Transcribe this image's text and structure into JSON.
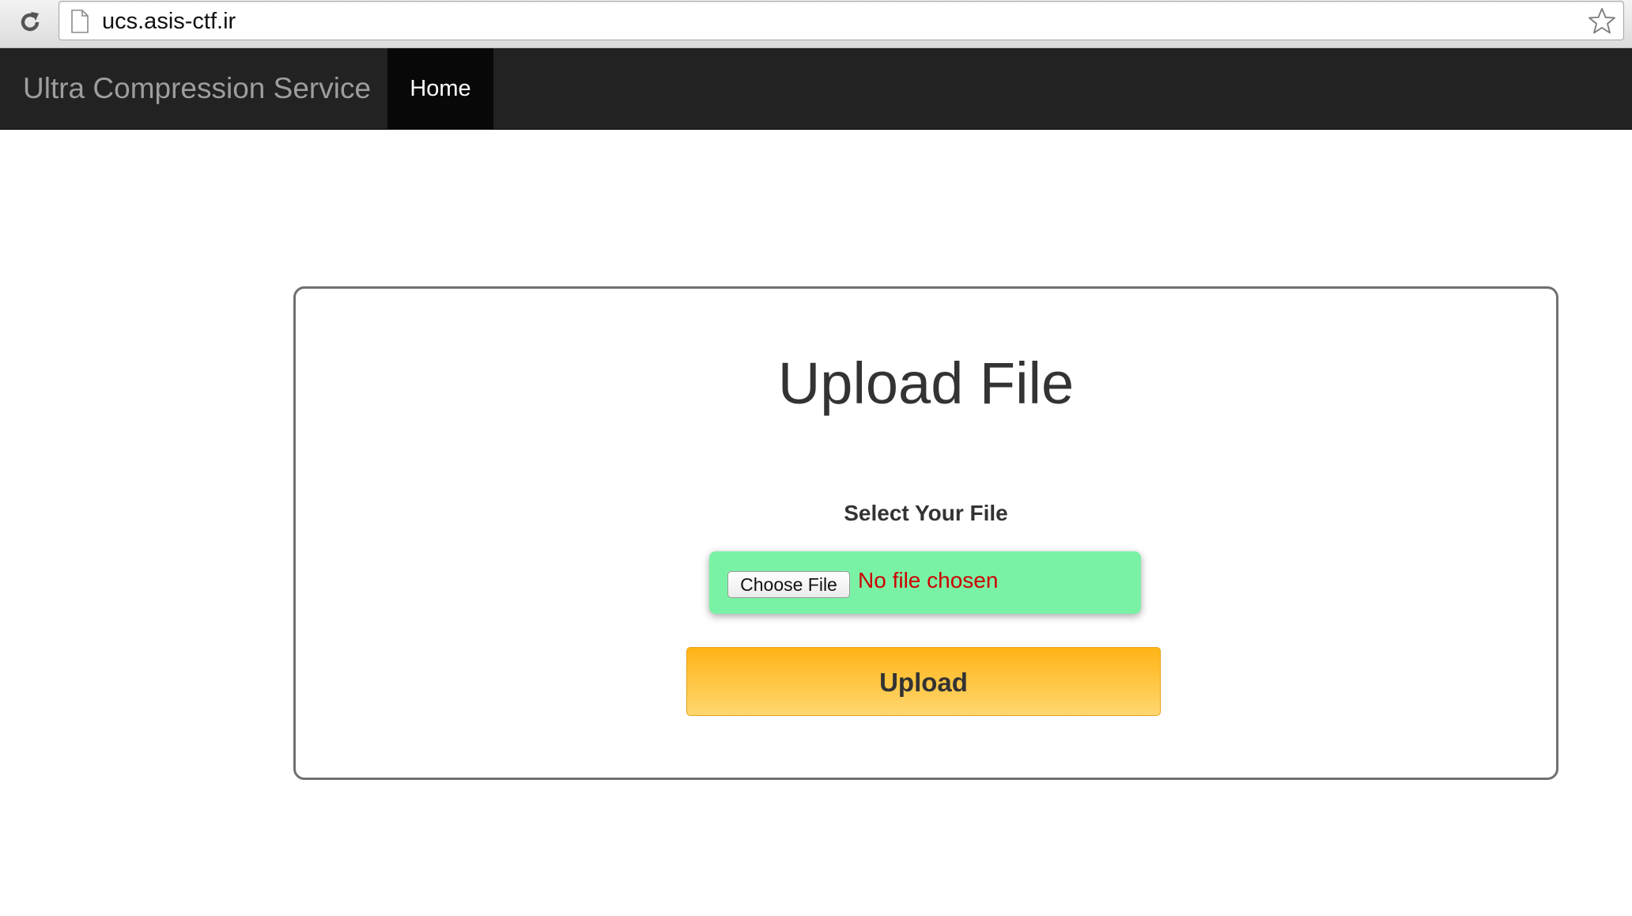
{
  "browser": {
    "url": "ucs.asis-ctf.ir",
    "reload_icon": "reload-icon",
    "page_icon": "document-icon",
    "bookmark_icon": "star-icon"
  },
  "navbar": {
    "brand": "Ultra Compression Service",
    "items": [
      {
        "label": "Home",
        "active": true
      }
    ]
  },
  "upload": {
    "title": "Upload File",
    "select_label": "Select Your File",
    "choose_file_label": "Choose File",
    "file_status": "No file chosen",
    "submit_label": "Upload"
  },
  "colors": {
    "navbar_bg": "#222222",
    "nav_active_bg": "#080808",
    "file_box_bg": "#7af2a6",
    "file_status": "#cc0000",
    "upload_btn_top": "#ffb416",
    "upload_btn_bottom": "#ffd770"
  }
}
